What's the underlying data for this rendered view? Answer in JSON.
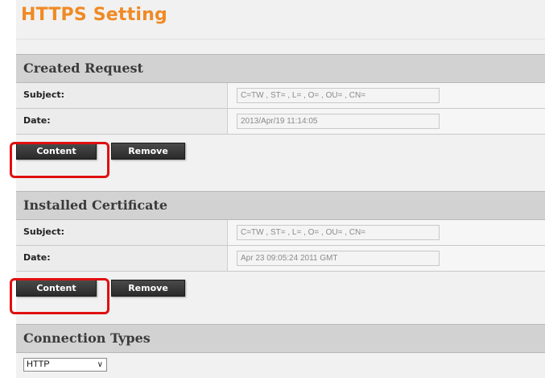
{
  "page": {
    "title": "HTTPS Setting"
  },
  "created_request": {
    "header": "Created Request",
    "subject_label": "Subject:",
    "subject_value": "C=TW , ST= , L= , O= , OU= , CN=",
    "date_label": "Date:",
    "date_value": "2013/Apr/19 11:14:05",
    "content_button": "Content",
    "remove_button": "Remove"
  },
  "installed_certificate": {
    "header": "Installed Certificate",
    "subject_label": "Subject:",
    "subject_value": "C=TW , ST= , L= , O= , OU= , CN=",
    "date_label": "Date:",
    "date_value": "Apr 23 09:05:24 2011 GMT",
    "content_button": "Content",
    "remove_button": "Remove"
  },
  "connection_types": {
    "header": "Connection Types",
    "selected": "HTTP"
  },
  "colors": {
    "title": "#f08a24",
    "highlight": "#e01010",
    "button": "#333333"
  }
}
